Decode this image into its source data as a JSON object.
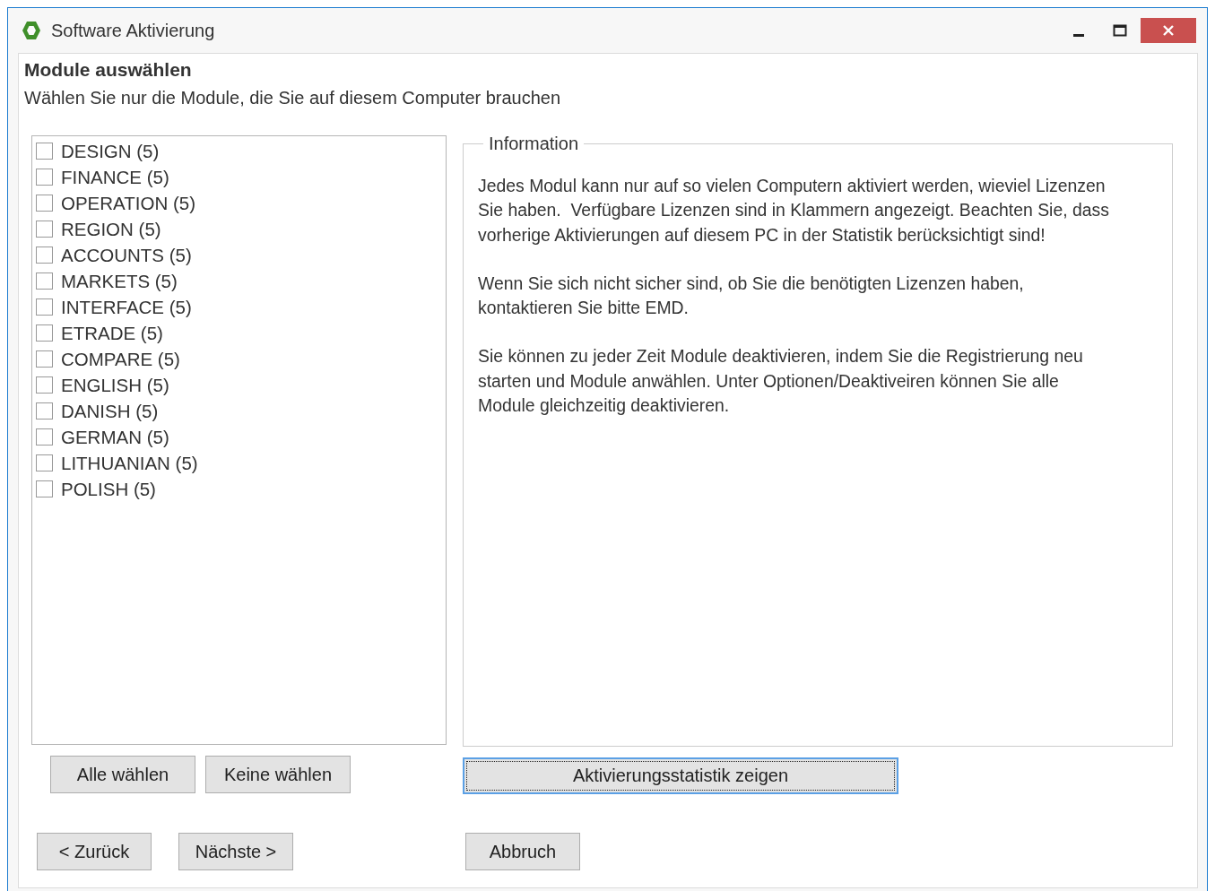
{
  "window": {
    "title": "Software Aktivierung"
  },
  "heading": "Module auswählen",
  "subtitle": "Wählen Sie nur die Module, die Sie auf diesem Computer brauchen",
  "modules": [
    {
      "label": "DESIGN (5)",
      "checked": false
    },
    {
      "label": "FINANCE (5)",
      "checked": false
    },
    {
      "label": "OPERATION (5)",
      "checked": false
    },
    {
      "label": "REGION (5)",
      "checked": false
    },
    {
      "label": "ACCOUNTS (5)",
      "checked": false
    },
    {
      "label": "MARKETS (5)",
      "checked": false
    },
    {
      "label": "INTERFACE (5)",
      "checked": false
    },
    {
      "label": "ETRADE (5)",
      "checked": false
    },
    {
      "label": "COMPARE (5)",
      "checked": false
    },
    {
      "label": "ENGLISH (5)",
      "checked": false
    },
    {
      "label": "DANISH (5)",
      "checked": false
    },
    {
      "label": "GERMAN (5)",
      "checked": false
    },
    {
      "label": "LITHUANIAN (5)",
      "checked": false
    },
    {
      "label": "POLISH (5)",
      "checked": false
    }
  ],
  "information": {
    "legend": "Information",
    "paragraphs": [
      "Jedes Modul kann nur auf so vielen Computern aktiviert werden, wieviel Lizenzen Sie haben.  Verfügbare Lizenzen sind in Klammern angezeigt. Beachten Sie, dass vorherige Aktivierungen auf diesem PC in der Statistik berücksichtigt sind!",
      "Wenn Sie sich nicht sicher sind, ob Sie die benötigten Lizenzen haben, kontaktieren Sie bitte EMD.",
      "Sie können zu jeder Zeit Module deaktivieren, indem Sie die Registrierung neu starten und Module anwählen. Unter Optionen/Deaktiveiren können Sie alle Module gleichzeitig deaktivieren."
    ]
  },
  "selection_buttons": [
    {
      "label": "Alle wählen"
    },
    {
      "label": "Keine wählen"
    }
  ],
  "statistics_button": {
    "label": "Aktivierungsstatistik zeigen",
    "focused": true
  },
  "navigation_buttons": [
    {
      "label": "< Zurück"
    },
    {
      "label": "Nächste >"
    },
    {
      "label": "Abbruch"
    }
  ]
}
